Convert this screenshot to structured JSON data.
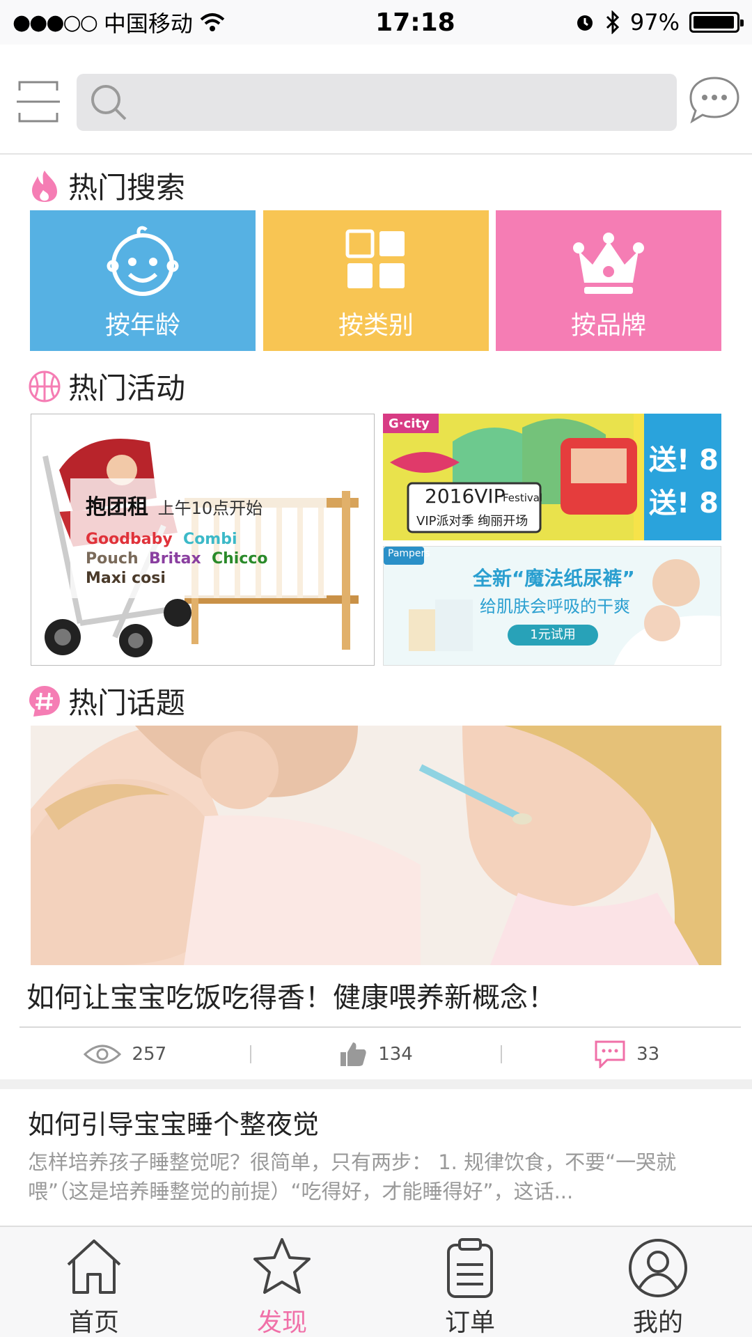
{
  "status_bar": {
    "signal": "●●●○○",
    "carrier": "中国移动",
    "time": "17:18",
    "battery": "97%",
    "battery_level": 0.97
  },
  "search": {
    "placeholder": ""
  },
  "hot_search": {
    "title": "热门搜索",
    "tiles": [
      {
        "label": "按年龄",
        "icon": "baby-face-icon",
        "color": "#56b1e3"
      },
      {
        "label": "按类别",
        "icon": "grid-icon",
        "color": "#f8c553"
      },
      {
        "label": "按品牌",
        "icon": "crown-icon",
        "color": "#f57db4"
      }
    ]
  },
  "hot_activities": {
    "title": "热门活动",
    "main": {
      "title": "抱团租",
      "subtitle": "上午10点开始",
      "brands": [
        "Goodbaby",
        "Combi",
        "Pouch",
        "Britax",
        "Chicco",
        "Maxi cosi"
      ]
    },
    "banner1": {
      "logo": "G·city",
      "headline": "2016VIP",
      "festival": "Festival",
      "subline": "VIP派对季 绚丽开场",
      "promo_a": "送! 8",
      "promo_b": "送! 8"
    },
    "banner2": {
      "brand": "Pampers",
      "headline": "全新“魔法纸尿裤”",
      "subline": "给肌肤会呼吸的干爽",
      "button": "1元试用"
    }
  },
  "hot_topics": {
    "title": "热门话题",
    "topic_title": "如何让宝宝吃饭吃得香！健康喂养新概念！",
    "views": "257",
    "likes": "134",
    "comments": "33"
  },
  "article": {
    "title": "如何引导宝宝睡个整夜觉",
    "body": "怎样培养孩子睡整觉呢？很简单，只有两步： 1. 规律饮食，不要“一哭就喂”（这是培养睡整觉的前提）“吃得好，才能睡得好”，这话..."
  },
  "tabbar": [
    {
      "label": "首页",
      "icon": "home-icon"
    },
    {
      "label": "发现",
      "icon": "star-icon",
      "active": true
    },
    {
      "label": "订单",
      "icon": "clipboard-icon"
    },
    {
      "label": "我的",
      "icon": "user-icon"
    }
  ],
  "colors": {
    "accent": "#f070a8",
    "blue": "#56b1e3",
    "yellow": "#f8c553",
    "pink": "#f57db4"
  }
}
